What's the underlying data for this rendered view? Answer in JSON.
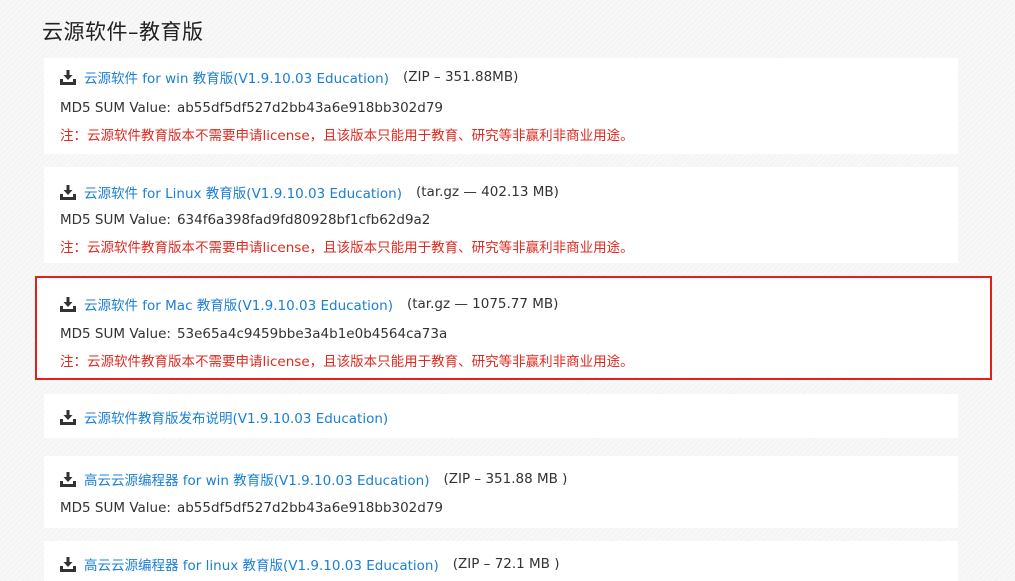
{
  "page": {
    "title": "云源软件–教育版"
  },
  "icons": {
    "download": "download-icon"
  },
  "colors": {
    "link": "#1a7fd4",
    "note": "#e02a20",
    "highlight_border": "#e0201c"
  },
  "downloads": [
    {
      "link_text": "云源软件 for win 教育版(V1.9.10.03 Education)",
      "size_text": "(ZIP – 351.88MB)",
      "md5_label": "MD5 SUM Value:",
      "md5_value": "ab55df5df527d2bb43a6e918bb302d79",
      "note": "注：云源软件教育版本不需要申请license，且该版本只能用于教育、研究等非赢利非商业用途。"
    },
    {
      "link_text": "云源软件 for Linux 教育版(V1.9.10.03 Education)",
      "size_text": "(tar.gz — 402.13 MB)",
      "md5_label": "MD5 SUM Value:",
      "md5_value": "634f6a398fad9fd80928bf1cfb62d9a2",
      "note": "注：云源软件教育版本不需要申请license，且该版本只能用于教育、研究等非赢利非商业用途。"
    },
    {
      "link_text": "云源软件 for Mac 教育版(V1.9.10.03 Education)",
      "size_text": "(tar.gz — 1075.77 MB)",
      "md5_label": "MD5 SUM Value:",
      "md5_value": "53e65a4c9459bbe3a4b1e0b4564ca73a",
      "note": "注：云源软件教育版本不需要申请license，且该版本只能用于教育、研究等非赢利非商业用途。",
      "highlighted": true
    },
    {
      "link_text": "云源软件教育版发布说明(V1.9.10.03 Education)"
    },
    {
      "link_text": "高云云源编程器 for win 教育版(V1.9.10.03 Education)",
      "size_text": "(ZIP – 351.88 MB )",
      "md5_label": "MD5 SUM Value:",
      "md5_value": "ab55df5df527d2bb43a6e918bb302d79"
    },
    {
      "link_text": "高云云源编程器 for linux 教育版(V1.9.10.03 Education)",
      "size_text": "(ZIP – 72.1 MB )"
    }
  ]
}
